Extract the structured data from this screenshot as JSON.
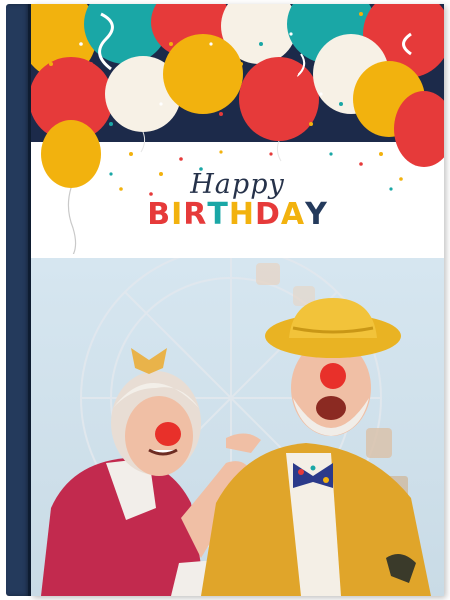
{
  "card": {
    "happy_text": "Happy",
    "birthday_letters": [
      "B",
      "I",
      "R",
      "T",
      "H",
      "D",
      "A",
      "Y"
    ],
    "birthday_colors": [
      "#e63a3a",
      "#f2b20e",
      "#e63a3a",
      "#1aa7a6",
      "#f2b20e",
      "#e63a3a",
      "#f2b20e",
      "#243a5c"
    ]
  },
  "colors": {
    "spine": "#243a5c",
    "balloon_red": "#e63a3a",
    "balloon_yellow": "#f2b20e",
    "balloon_teal": "#1aa7a6",
    "balloon_white": "#f7f1e6",
    "background_navy": "#1c2a4a",
    "coat_mustard": "#e0a52a",
    "jacket_magenta": "#c22a4e"
  },
  "photo": {
    "description_icon": "elderly-couple-clown-noses-photo"
  }
}
